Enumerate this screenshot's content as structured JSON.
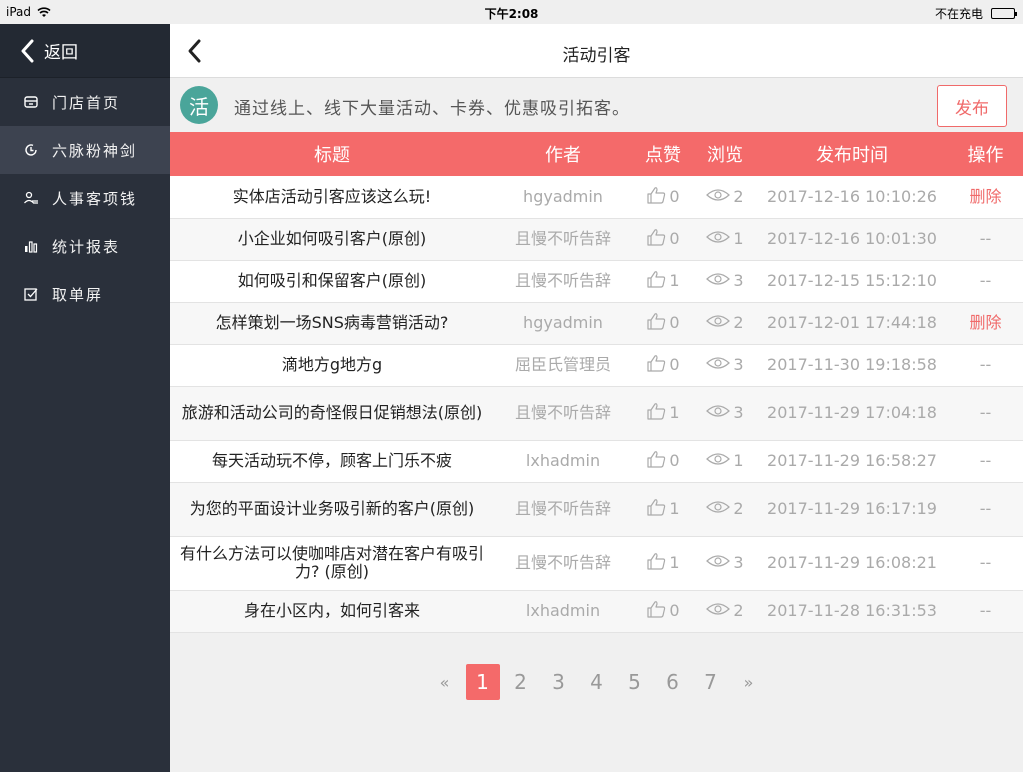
{
  "status_bar": {
    "device": "iPad",
    "time": "下午2:08",
    "charging": "不在充电"
  },
  "sidebar": {
    "back_label": "返回",
    "items": [
      {
        "label": "门店首页",
        "icon": "store-icon",
        "active": false
      },
      {
        "label": "六脉粉神剑",
        "icon": "refresh-icon",
        "active": true
      },
      {
        "label": "人事客项钱",
        "icon": "people-icon",
        "active": false
      },
      {
        "label": "统计报表",
        "icon": "bar-chart-icon",
        "active": false
      },
      {
        "label": "取单屏",
        "icon": "checkbox-icon",
        "active": false
      }
    ]
  },
  "header": {
    "title": "活动引客"
  },
  "banner": {
    "badge": "活",
    "text": "通过线上、线下大量活动、卡券、优惠吸引拓客。",
    "publish_label": "发布"
  },
  "table": {
    "columns": [
      "标题",
      "作者",
      "点赞",
      "浏览",
      "发布时间",
      "操作"
    ],
    "rows": [
      {
        "title": "实体店活动引客应该这么玩!",
        "author": "hgyadmin",
        "likes": "0",
        "views": "2",
        "time": "2017-12-16 10:10:26",
        "op": "删除"
      },
      {
        "title": "小企业如何吸引客户(原创)",
        "author": "且慢不听告辞",
        "likes": "0",
        "views": "1",
        "time": "2017-12-16 10:01:30",
        "op": "--"
      },
      {
        "title": "如何吸引和保留客户(原创)",
        "author": "且慢不听告辞",
        "likes": "1",
        "views": "3",
        "time": "2017-12-15 15:12:10",
        "op": "--"
      },
      {
        "title": "怎样策划一场SNS病毒营销活动?",
        "author": "hgyadmin",
        "likes": "0",
        "views": "2",
        "time": "2017-12-01 17:44:18",
        "op": "删除"
      },
      {
        "title": "滴地方g地方g",
        "author": "屈臣氏管理员",
        "likes": "0",
        "views": "3",
        "time": "2017-11-30 19:18:58",
        "op": "--"
      },
      {
        "title": "旅游和活动公司的奇怪假日促销想法(原创)",
        "author": "且慢不听告辞",
        "likes": "1",
        "views": "3",
        "time": "2017-11-29 17:04:18",
        "op": "--"
      },
      {
        "title": "每天活动玩不停，顾客上门乐不疲",
        "author": "lxhadmin",
        "likes": "0",
        "views": "1",
        "time": "2017-11-29 16:58:27",
        "op": "--"
      },
      {
        "title": "为您的平面设计业务吸引新的客户(原创)",
        "author": "且慢不听告辞",
        "likes": "1",
        "views": "2",
        "time": "2017-11-29 16:17:19",
        "op": "--"
      },
      {
        "title": "有什么方法可以使咖啡店对潜在客户有吸引力? (原创)",
        "author": "且慢不听告辞",
        "likes": "1",
        "views": "3",
        "time": "2017-11-29 16:08:21",
        "op": "--"
      },
      {
        "title": "身在小区内，如何引客来",
        "author": "lxhadmin",
        "likes": "0",
        "views": "2",
        "time": "2017-11-28 16:31:53",
        "op": "--"
      }
    ]
  },
  "pagination": {
    "prev": "«",
    "next": "»",
    "pages": [
      "1",
      "2",
      "3",
      "4",
      "5",
      "6",
      "7"
    ],
    "current": "1"
  },
  "colors": {
    "accent": "#f46a6a",
    "sidebar_bg": "#2a303b",
    "badge": "#4aa59a"
  }
}
